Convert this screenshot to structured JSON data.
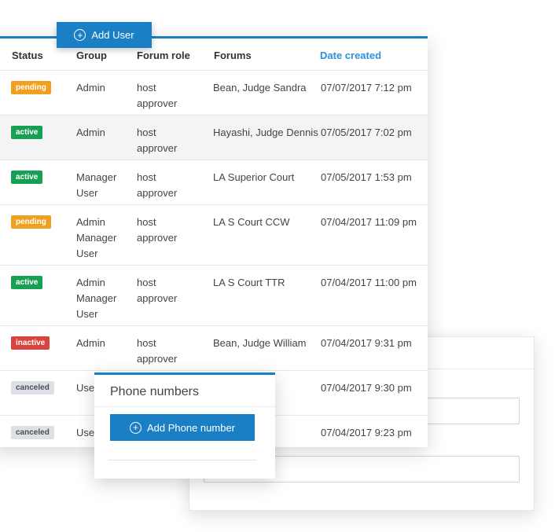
{
  "header": {
    "status": "Status",
    "group": "Group",
    "forum_role": "Forum role",
    "forums": "Forums",
    "date_created": "Date created"
  },
  "add_user_label": "Add User",
  "rows": [
    {
      "status": "pending",
      "group": [
        "Admin"
      ],
      "role": [
        "host",
        "approver"
      ],
      "forum": "Bean, Judge Sandra",
      "date": "07/07/2017 7:12 pm"
    },
    {
      "status": "active",
      "group": [
        "Admin"
      ],
      "role": [
        "host",
        "approver"
      ],
      "forum": "Hayashi, Judge Dennis",
      "date": "07/05/2017 7:02 pm"
    },
    {
      "status": "active",
      "group": [
        "Manager",
        "User"
      ],
      "role": [
        "host",
        "approver"
      ],
      "forum": "LA Superior Court",
      "date": "07/05/2017 1:53 pm"
    },
    {
      "status": "pending",
      "group": [
        "Admin",
        "Manager",
        "User"
      ],
      "role": [
        "host",
        "approver"
      ],
      "forum": "LA S Court CCW",
      "date": "07/04/2017 11:09 pm"
    },
    {
      "status": "active",
      "group": [
        "Admin",
        "Manager",
        "User"
      ],
      "role": [
        "host",
        "approver"
      ],
      "forum": "LA S Court TTR",
      "date": "07/04/2017 11:00 pm"
    },
    {
      "status": "inactive",
      "group": [
        "Admin"
      ],
      "role": [
        "host",
        "approver"
      ],
      "forum": "Bean, Judge William",
      "date": "07/04/2017 9:31 pm"
    },
    {
      "status": "canceled",
      "group": [
        "User"
      ],
      "role": [],
      "forum": "",
      "date": "07/04/2017 9:30 pm"
    },
    {
      "status": "canceled",
      "group": [
        "User"
      ],
      "role": [],
      "forum": "",
      "date": "07/04/2017 9:23 pm"
    }
  ],
  "phone_card": {
    "title": "Phone numbers",
    "add_label": "Add Phone number"
  },
  "colors": {
    "accent": "#1a7fc4",
    "pending": "#f0a020",
    "active": "#17a054",
    "inactive": "#d9453e",
    "canceled": "#dde1e6"
  }
}
